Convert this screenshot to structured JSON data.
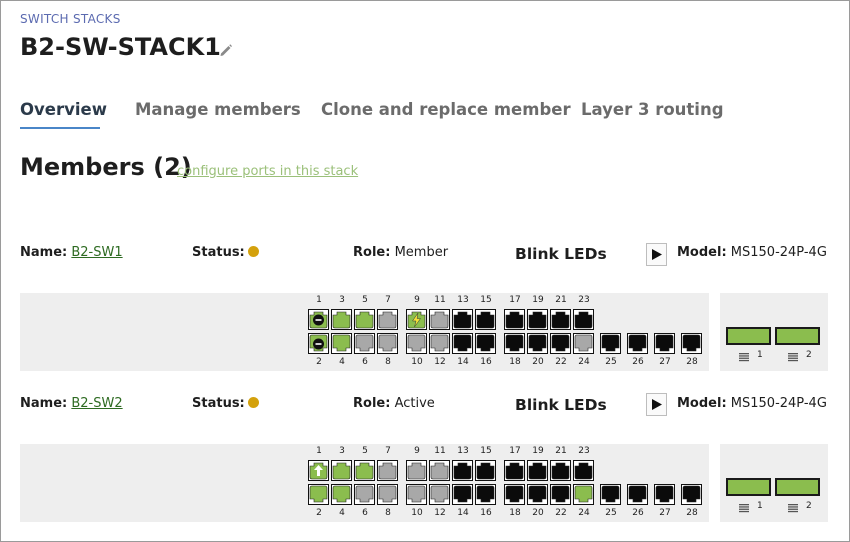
{
  "breadcrumb": "SWITCH STACKS",
  "title": "B2-SW-STACK1",
  "tabs": [
    "Overview",
    "Manage members",
    "Clone and replace member",
    "Layer 3 routing"
  ],
  "members_heading": "Members (2)",
  "configure_link": "configure ports in this stack",
  "labels": {
    "name": "Name:",
    "status": "Status:",
    "role": "Role:",
    "blink": "Blink LEDs",
    "model": "Model:"
  },
  "colors": {
    "connected": "#8bbd4e",
    "disabled": "#a8a8a8",
    "disconnected": "#0b0b0b",
    "status_warning": "#d4a10c",
    "link": "#2e6b22"
  },
  "members": [
    {
      "name": "B2-SW1",
      "role": "Member",
      "model": "MS150-24P-4G",
      "ports": {
        "1": "green-blocked",
        "2": "green-blocked",
        "3": "green",
        "4": "green",
        "5": "green",
        "6": "gray",
        "7": "gray",
        "8": "gray",
        "9": "green-poe",
        "10": "gray",
        "11": "gray",
        "12": "gray",
        "13": "black",
        "14": "black",
        "15": "black",
        "16": "black",
        "17": "black",
        "18": "black",
        "19": "black",
        "20": "black",
        "21": "black",
        "22": "black",
        "23": "black",
        "24": "gray",
        "25": "black",
        "26": "black",
        "27": "black",
        "28": "black"
      },
      "uplinks": [
        {
          "label": "1",
          "state": "green"
        },
        {
          "label": "2",
          "state": "green"
        }
      ]
    },
    {
      "name": "B2-SW2",
      "role": "Active",
      "model": "MS150-24P-4G",
      "ports": {
        "1": "green-up",
        "2": "green",
        "3": "green",
        "4": "green",
        "5": "green",
        "6": "gray",
        "7": "gray",
        "8": "gray",
        "9": "gray",
        "10": "gray",
        "11": "gray",
        "12": "gray",
        "13": "black",
        "14": "black",
        "15": "black",
        "16": "black",
        "17": "black",
        "18": "black",
        "19": "black",
        "20": "black",
        "21": "black",
        "22": "black",
        "23": "black",
        "24": "green",
        "25": "black",
        "26": "black",
        "27": "black",
        "28": "black"
      },
      "uplinks": [
        {
          "label": "1",
          "state": "green"
        },
        {
          "label": "2",
          "state": "green"
        }
      ]
    }
  ]
}
